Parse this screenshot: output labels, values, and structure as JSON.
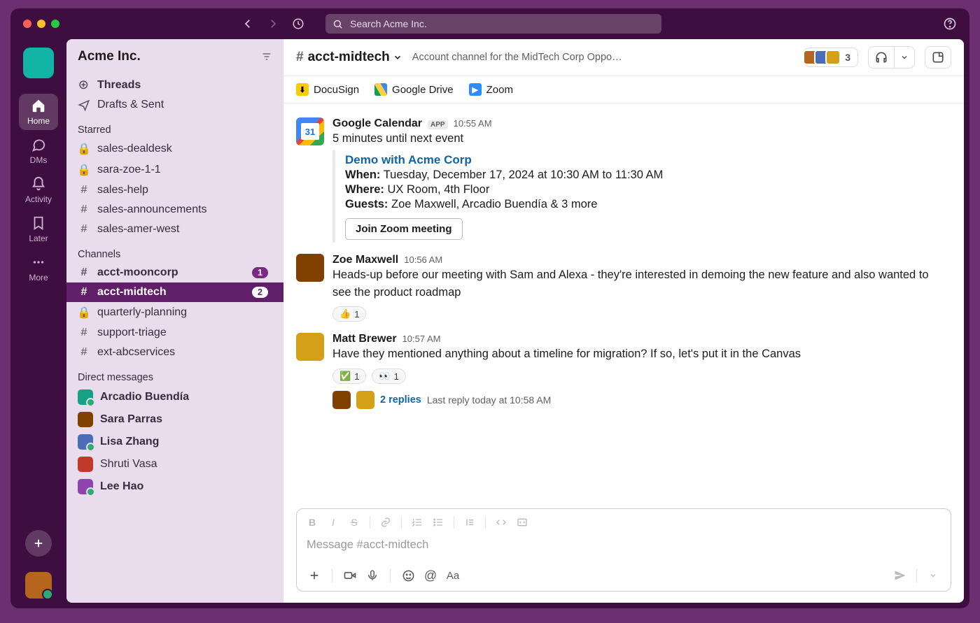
{
  "search": {
    "placeholder": "Search Acme Inc."
  },
  "workspace": {
    "name": "Acme Inc."
  },
  "rail": {
    "home": "Home",
    "dms": "DMs",
    "activity": "Activity",
    "later": "Later",
    "more": "More"
  },
  "sidebar": {
    "threads": "Threads",
    "drafts": "Drafts & Sent",
    "sections": {
      "starred": "Starred",
      "channels": "Channels",
      "dms": "Direct messages"
    },
    "starred": [
      {
        "name": "sales-dealdesk",
        "type": "lock"
      },
      {
        "name": "sara-zoe-1-1",
        "type": "lock"
      },
      {
        "name": "sales-help",
        "type": "hash"
      },
      {
        "name": "sales-announcements",
        "type": "hash"
      },
      {
        "name": "sales-amer-west",
        "type": "hash"
      }
    ],
    "channels": [
      {
        "name": "acct-mooncorp",
        "type": "hash",
        "bold": true,
        "badge": "1"
      },
      {
        "name": "acct-midtech",
        "type": "hash",
        "bold": true,
        "badge": "2",
        "active": true
      },
      {
        "name": "quarterly-planning",
        "type": "lock"
      },
      {
        "name": "support-triage",
        "type": "hash"
      },
      {
        "name": "ext-abcservices",
        "type": "hash"
      }
    ],
    "dms": [
      {
        "name": "Arcadio Buendía",
        "bold": true
      },
      {
        "name": "Sara Parras",
        "bold": true
      },
      {
        "name": "Lisa Zhang",
        "bold": true
      },
      {
        "name": "Shruti Vasa"
      },
      {
        "name": "Lee Hao",
        "bold": true
      }
    ]
  },
  "channel": {
    "name": "acct-midtech",
    "topic": "Account channel for the MidTech Corp Oppo…",
    "memberCount": "3",
    "bookmarks": [
      {
        "label": "DocuSign"
      },
      {
        "label": "Google Drive"
      },
      {
        "label": "Zoom"
      }
    ]
  },
  "messages": {
    "gcal": {
      "name": "Google Calendar",
      "app": "APP",
      "time": "10:55 AM",
      "lead": "5 minutes until next event",
      "title": "Demo with Acme Corp",
      "when_l": "When:",
      "when": "Tuesday, December 17, 2024 at 10:30 AM to 11:30 AM",
      "where_l": "Where:",
      "where": "UX Room, 4th Floor",
      "guests_l": "Guests:",
      "guests": "Zoe Maxwell, Arcadio Buendía & 3 more",
      "join": "Join Zoom meeting"
    },
    "zoe": {
      "name": "Zoe Maxwell",
      "time": "10:56 AM",
      "text": "Heads-up before our meeting with Sam and Alexa - they're interested in demoing the new feature and also wanted to see the product roadmap",
      "react1": "👍",
      "react1c": "1"
    },
    "matt": {
      "name": "Matt Brewer",
      "time": "10:57 AM",
      "text": "Have they mentioned anything about a timeline for migration? If so, let's put it in the Canvas",
      "react1": "✅",
      "react1c": "1",
      "react2": "👀",
      "react2c": "1",
      "replies": "2 replies",
      "last": "Last reply today at 10:58 AM"
    }
  },
  "composer": {
    "placeholder": "Message #acct-midtech"
  }
}
